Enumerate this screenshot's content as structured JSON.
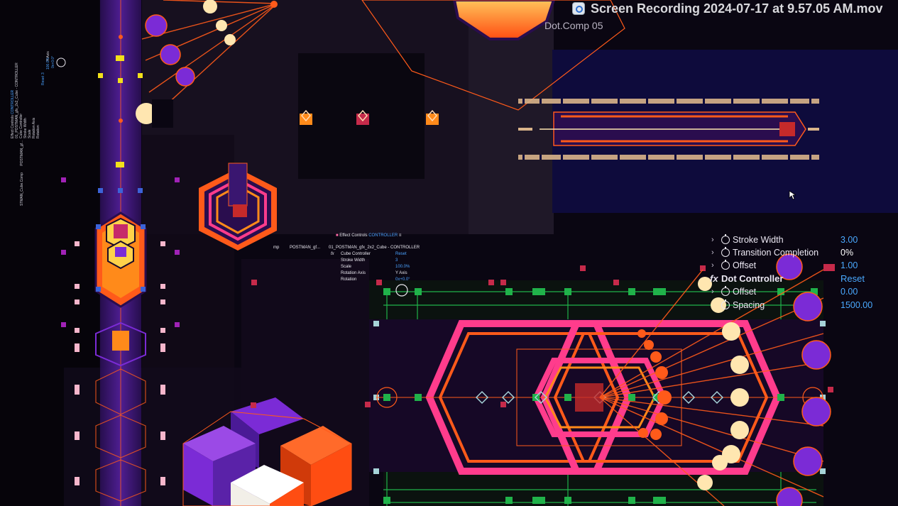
{
  "window": {
    "title": "Screen Recording 2024-07-17 at 9.57.05 AM.mov",
    "comp_tab": "Dot.Comp 05"
  },
  "effect_controls_small": {
    "panel_title": "Effect Controls",
    "panel_layer": "CONTROLLER",
    "breadcrumb_left": "mp",
    "breadcrumb_mid": "POSTMAN_gf...",
    "breadcrumb_right": "01_POSTMAN_gfx_2x2_Cube - CONTROLLER",
    "effect_name": "Cube Controller",
    "reset": "Reset",
    "props": [
      {
        "name": "Stroke Width",
        "value": "3"
      },
      {
        "name": "Scale",
        "value": "100.0%"
      },
      {
        "name": "Rotation Axis",
        "value": "Y Axis"
      },
      {
        "name": "Rotation",
        "value": "0x+0.0°"
      }
    ]
  },
  "effect_controls_rotated": {
    "panel_title": "Effect Controls",
    "panel_layer": "CONTROLLER",
    "breadcrumb": "01_POSTMAN_gfx_2x2_Cube - CONTROLLER",
    "effect_name": "Cube Controller",
    "comp": "STMAN_Cube.Comp",
    "comp_mid": "POSTMAN_gf...",
    "props": [
      "Stroke Width",
      "Scale",
      "Rotation Axis",
      "Rotation"
    ],
    "values": [
      "Reset",
      "3",
      "100.0%",
      "Y Axis",
      "0x+0.0°"
    ]
  },
  "effect_controls_big": {
    "rows": [
      {
        "name": "Stroke Width",
        "value": "3.00"
      },
      {
        "name": "Transition Completion",
        "value": "0%"
      },
      {
        "name": "Offset",
        "value": "1.00"
      }
    ],
    "effect": {
      "name": "Dot Controller",
      "reset": "Reset"
    },
    "effect_rows": [
      {
        "name": "Offset",
        "value": "0.00"
      },
      {
        "name": "Spacing",
        "value": "1500.00"
      }
    ]
  },
  "colors": {
    "purple": "#7b2bd6",
    "deep_purple": "#2a0d4e",
    "orange": "#ff5a1a",
    "magenta": "#ff3c8c",
    "pink_hex": "#ff4fa0",
    "peach": "#ffe6b0",
    "navy": "#100d44",
    "param_blue": "#4aa9ff",
    "green_handle": "#20b24a"
  },
  "icons": [
    "quicktime-icon",
    "stopwatch-icon",
    "chevron-right-icon",
    "fx-icon",
    "cursor-arrow-icon"
  ]
}
